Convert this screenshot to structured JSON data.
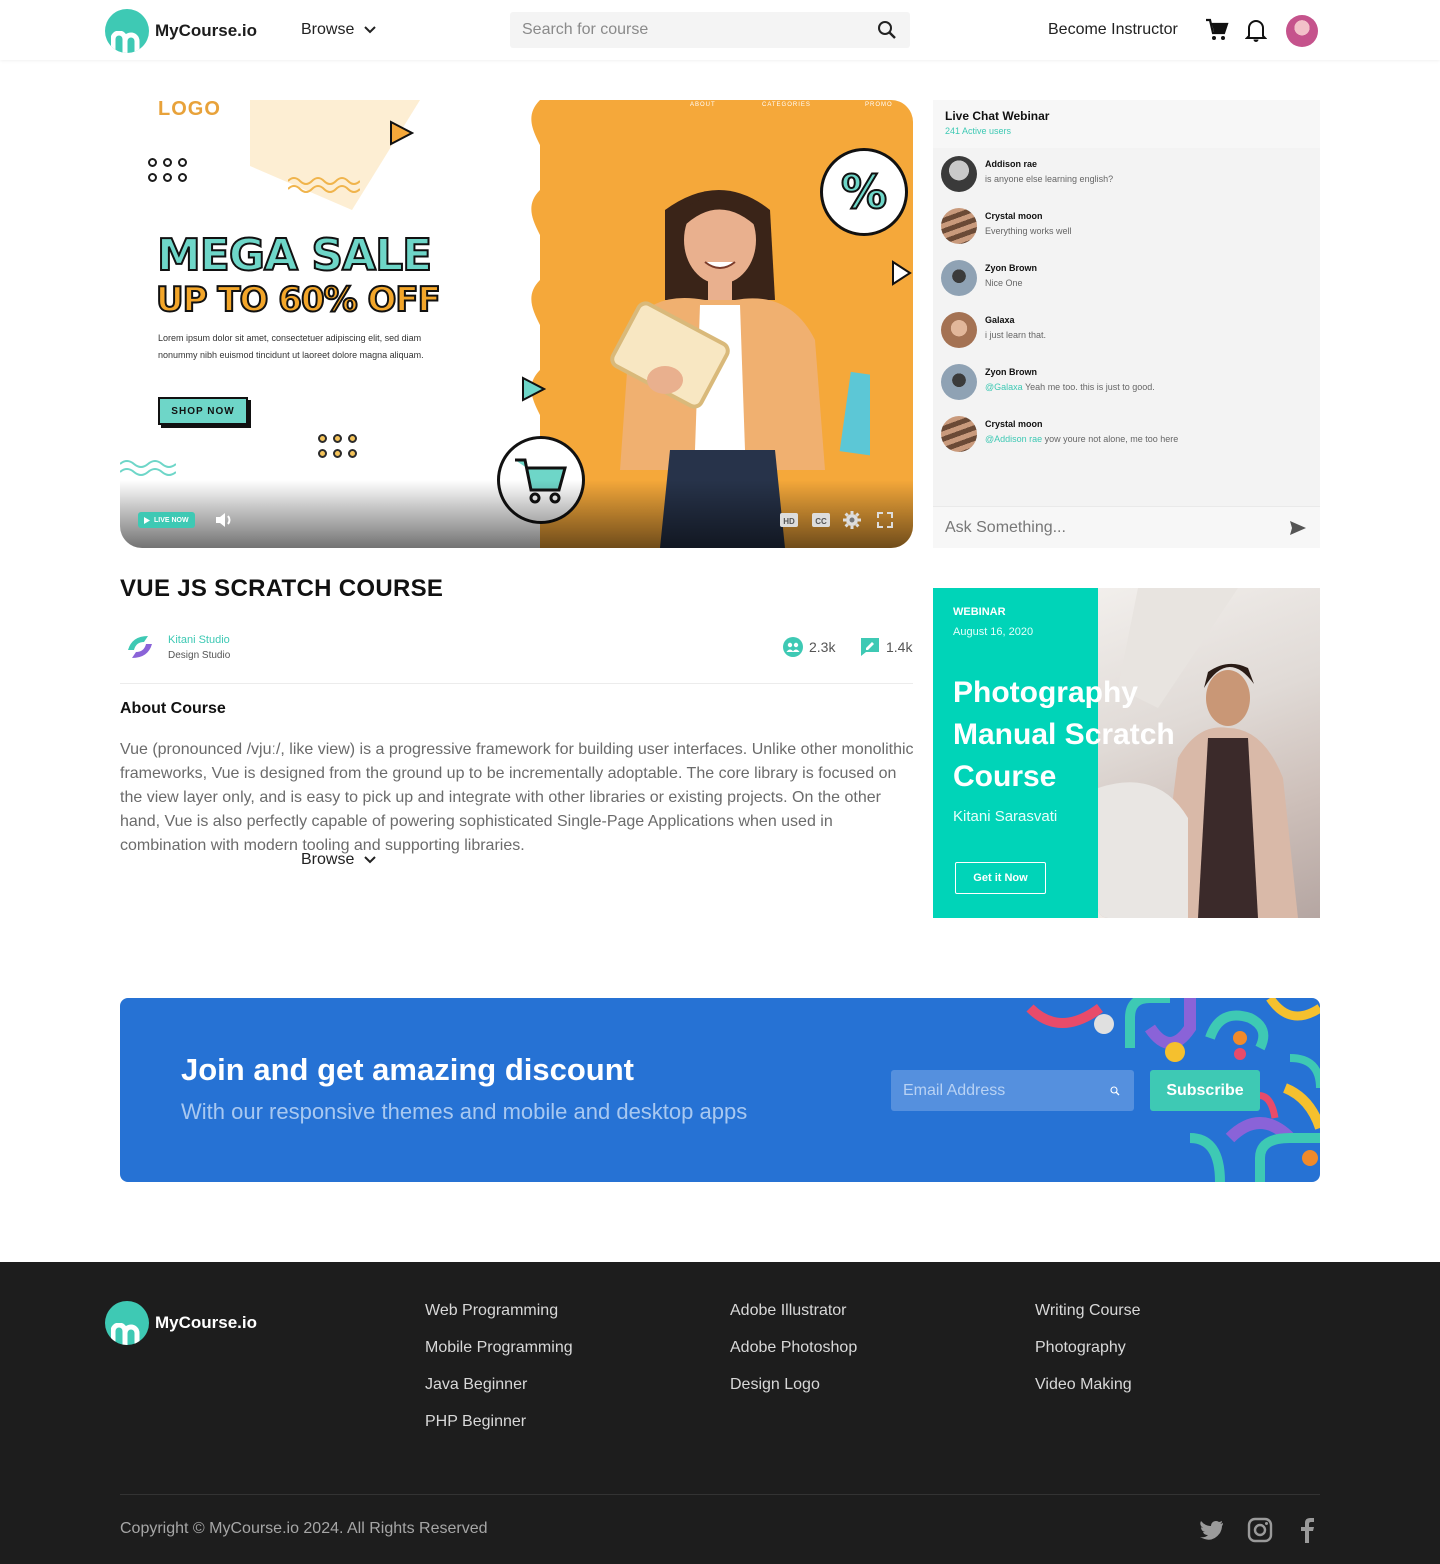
{
  "header": {
    "logo_text": "MyCourse.io",
    "browse_label": "Browse",
    "search_placeholder": "Search for course",
    "become_instructor": "Become Instructor",
    "icons": [
      "cart-icon",
      "bell-icon",
      "avatar"
    ]
  },
  "video": {
    "banner": {
      "logo": "LOGO",
      "nav": [
        "ABOUT",
        "CATEGORIES",
        "PROMO"
      ],
      "headline": "MEGA SALE",
      "subheadline": "UP TO 60% OFF",
      "body": "Lorem ipsum dolor sit amet, consectetuer adipiscing elit, sed diam nonummy nibh euismod tincidunt ut laoreet dolore magna aliquam.",
      "cta": "SHOP NOW",
      "percent": "%"
    },
    "live_label": "LIVE NOW",
    "controls": [
      "volume-icon",
      "hd-icon",
      "cc-icon",
      "settings-icon",
      "fullscreen-icon"
    ]
  },
  "chat": {
    "title": "Live Chat Webinar",
    "active_users": "241 Active users",
    "messages": [
      {
        "name": "Addison rae",
        "mention": "",
        "text": "is anyone else learning english?"
      },
      {
        "name": "Crystal moon",
        "mention": "",
        "text": "Everything works well"
      },
      {
        "name": "Zyon Brown",
        "mention": "",
        "text": "Nice One"
      },
      {
        "name": "Galaxa",
        "mention": "",
        "text": "i just learn that."
      },
      {
        "name": "Zyon Brown",
        "mention": "@Galaxa",
        "text": " Yeah me too. this is just to good."
      },
      {
        "name": "Crystal moon",
        "mention": "@Addison rae",
        "text": " yow youre not alone, me too here"
      }
    ],
    "input_placeholder": "Ask Something..."
  },
  "course": {
    "title": "VUE JS SCRATCH COURSE",
    "studio_name": "Kitani Studio",
    "studio_type": "Design Studio",
    "students": "2.3k",
    "comments": "1.4k",
    "about_heading": "About Course",
    "about_text": "Vue (pronounced /vjuː/, like view) is a progressive framework for building user interfaces. Unlike other monolithic frameworks, Vue is designed from the ground up to be incrementally adoptable. The core library is focused on the view layer only, and is easy to pick up and integrate with other libraries or existing projects. On the other hand, Vue is also perfectly capable of powering sophisticated Single-Page Applications when used in combination with modern tooling and supporting libraries.",
    "browse_label": "Browse"
  },
  "webinar_card": {
    "tag": "WEBINAR",
    "date": "August 16, 2020",
    "title": "Photography Manual Scratch Course",
    "author": "Kitani Sarasvati",
    "cta": "Get it Now"
  },
  "newsletter": {
    "heading": "Join and get amazing discount",
    "subheading": "With our responsive themes and mobile and desktop apps",
    "email_placeholder": "Email Address",
    "button": "Subscribe"
  },
  "footer": {
    "logo_text": "MyCourse.io",
    "columns": [
      [
        "Web Programming",
        "Mobile Programming",
        "Java Beginner",
        "PHP Beginner"
      ],
      [
        "Adobe Illustrator",
        "Adobe Photoshop",
        "Design Logo"
      ],
      [
        "Writing Course",
        "Photography",
        "Video Making"
      ]
    ],
    "copyright": "Copyright © MyCourse.io 2024. All Rights Reserved",
    "social": [
      "twitter-icon",
      "instagram-icon",
      "facebook-icon"
    ]
  },
  "colors": {
    "accent": "#3ec9b4",
    "webinar_teal": "#00d4b8",
    "newsletter_blue": "#2672d4",
    "footer_bg": "#1d1d1d"
  }
}
